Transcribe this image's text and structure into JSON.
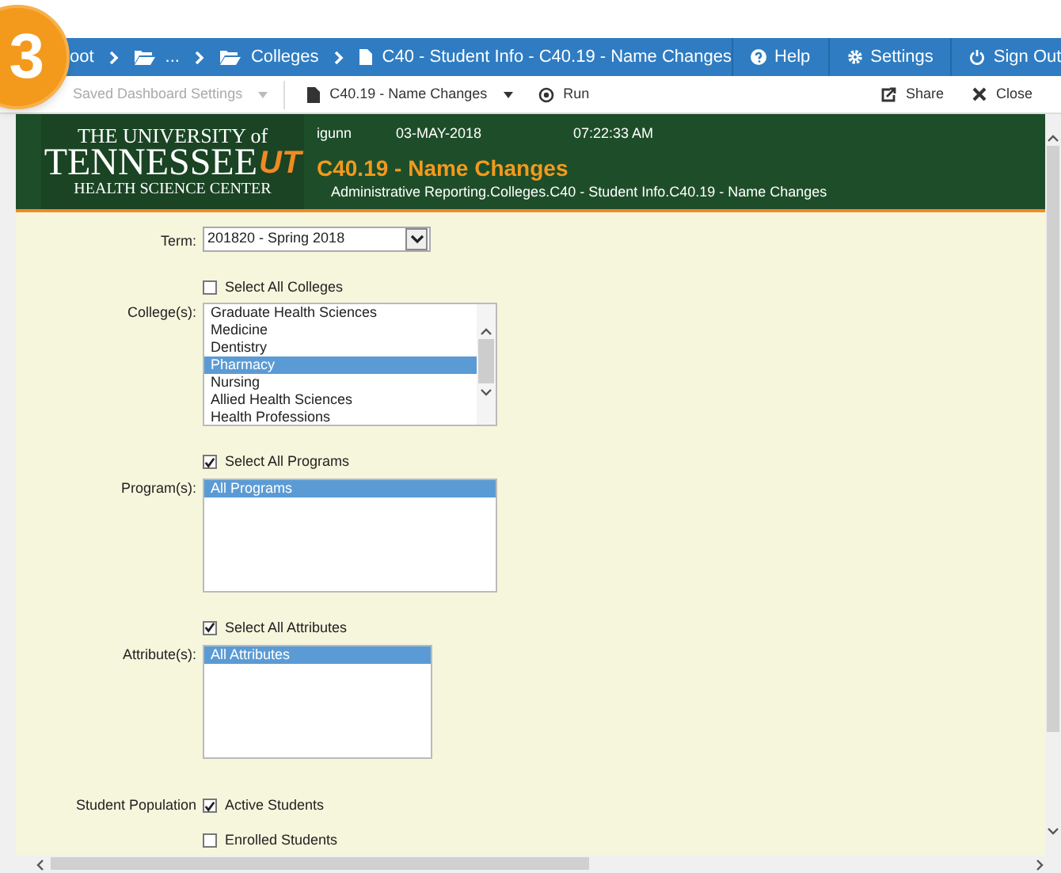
{
  "badge": "3",
  "breadcrumbs": [
    {
      "label": "oot"
    },
    {
      "label": "..."
    },
    {
      "label": "Colleges"
    },
    {
      "label": "C40 - Student Info - C40.19 - Name Changes"
    }
  ],
  "nav_buttons": [
    {
      "label": "Help"
    },
    {
      "label": "Settings"
    },
    {
      "label": "Sign Out"
    }
  ],
  "toolbar_left": [
    {
      "label": "Saved Dashboard Settings",
      "disabled": true
    },
    {
      "label": "C40.19 - Name Changes",
      "disabled": false
    },
    {
      "label": "Run",
      "disabled": false
    }
  ],
  "toolbar_right": [
    {
      "label": "Share"
    },
    {
      "label": "Close"
    }
  ],
  "header": {
    "logo_top": "THE UNIVERSITY of",
    "logo_main": "TENNESSEE",
    "logo_mark": "UT",
    "logo_bottom": "HEALTH SCIENCE CENTER",
    "user": "igunn",
    "date": "03-MAY-2018",
    "time": "07:22:33 AM",
    "title": "C40.19 - Name Changes",
    "path": "Administrative Reporting.Colleges.C40 - Student Info.C40.19 - Name Changes"
  },
  "term": {
    "label": "Term:",
    "value": "201820 - Spring 2018"
  },
  "lists": [
    {
      "select_all": {
        "label": "Select All Colleges",
        "checked": false
      },
      "label": "College(s):",
      "options": [
        {
          "label": "Graduate Health Sciences",
          "selected": false
        },
        {
          "label": "Medicine",
          "selected": false
        },
        {
          "label": "Dentistry",
          "selected": false
        },
        {
          "label": "Pharmacy",
          "selected": true
        },
        {
          "label": "Nursing",
          "selected": false
        },
        {
          "label": "Allied Health Sciences",
          "selected": false
        },
        {
          "label": "Health Professions",
          "selected": false
        }
      ]
    },
    {
      "select_all": {
        "label": "Select All Programs",
        "checked": true
      },
      "label": "Program(s):",
      "options": [
        {
          "label": "All Programs",
          "selected": true
        }
      ]
    },
    {
      "select_all": {
        "label": "Select All Attributes",
        "checked": true
      },
      "label": "Attribute(s):",
      "options": [
        {
          "label": "All Attributes",
          "selected": true
        }
      ]
    }
  ],
  "student_population": {
    "label": "Student Population",
    "options": [
      {
        "label": "Active Students",
        "checked": true
      },
      {
        "label": "Enrolled Students",
        "checked": false
      }
    ]
  }
}
